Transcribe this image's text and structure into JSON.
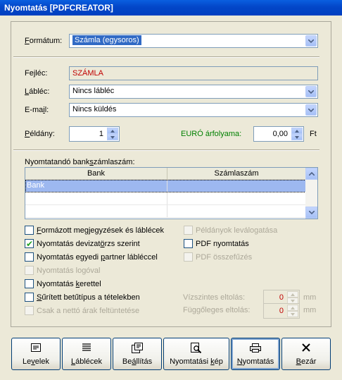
{
  "window": {
    "title": "Nyomtatás [PDFCREATOR]"
  },
  "format": {
    "label_pre": "F",
    "label_rest": "ormátum:",
    "value": "Számla (egysoros)"
  },
  "header": {
    "label_pre": "Fe",
    "label_u": "j",
    "label_rest": "léc:",
    "value": "SZÁMLA"
  },
  "footer": {
    "label_pre": "",
    "label_u": "L",
    "label_rest": "ábléc:",
    "value": "Nincs lábléc"
  },
  "email": {
    "label_pre": "E-ma",
    "label_u": "i",
    "label_rest": "l:",
    "value": "Nincs küldés"
  },
  "copies": {
    "label_pre": "",
    "label_u": "P",
    "label_rest": "éldány:",
    "value": "1"
  },
  "euro": {
    "label": "EURÓ árfolyama:",
    "value": "0,00",
    "unit": "Ft",
    "color": "#008000"
  },
  "bank_section": {
    "label_pre": "Nyomtatandó bank",
    "label_u": "s",
    "label_rest": "zámlaszám:"
  },
  "bank_table": {
    "columns": [
      "Bank",
      "Számlaszám"
    ],
    "rows": [
      [
        "Bank",
        ""
      ],
      [
        "",
        ""
      ],
      [
        "",
        ""
      ]
    ]
  },
  "checkboxes_left": [
    {
      "label_pre": "",
      "label_u": "F",
      "label_rest": "ormázott megjegyzések és láblécek",
      "checked": false,
      "enabled": true
    },
    {
      "label_pre": "Nyomtatás devizat",
      "label_u": "ö",
      "label_rest": "rzs szerint",
      "checked": true,
      "enabled": true
    },
    {
      "label_pre": "Nyomtatás egyedi ",
      "label_u": "p",
      "label_rest": "artner lábléccel",
      "checked": false,
      "enabled": true
    },
    {
      "label_pre": "Nyomtatás logóval",
      "label_u": "",
      "label_rest": "",
      "checked": false,
      "enabled": false
    },
    {
      "label_pre": "Nyomtatás ",
      "label_u": "k",
      "label_rest": "erettel",
      "checked": false,
      "enabled": true
    },
    {
      "label_pre": "",
      "label_u": "S",
      "label_rest": "űrített betűtípus a tételekben",
      "checked": false,
      "enabled": true
    },
    {
      "label_pre": "Csak a nettó árak feltüntetése",
      "label_u": "",
      "label_rest": "",
      "checked": false,
      "enabled": false
    }
  ],
  "checkboxes_right": [
    {
      "label": "Példányok leválogatása",
      "checked": false,
      "enabled": false
    },
    {
      "label": "PDF nyomtatás",
      "checked": false,
      "enabled": true
    },
    {
      "label": "PDF összefűzés",
      "checked": false,
      "enabled": false
    }
  ],
  "offset_h": {
    "label": "Vízszintes eltolás:",
    "value": "0",
    "unit": "mm"
  },
  "offset_v": {
    "label": "Függőleges eltolás:",
    "value": "0",
    "unit": "mm"
  },
  "buttons": [
    {
      "label_pre": "Le",
      "label_u": "v",
      "label_rest": "elek",
      "icon": "letter-icon"
    },
    {
      "label_pre": "",
      "label_u": "L",
      "label_rest": "áblécek",
      "icon": "lines-icon"
    },
    {
      "label_pre": "Be",
      "label_u": "á",
      "label_rest": "llítás",
      "icon": "settings-icon"
    },
    {
      "label_pre": "Nyomtatási ",
      "label_u": "k",
      "label_rest": "ép",
      "icon": "preview-icon"
    },
    {
      "label_pre": "",
      "label_u": "N",
      "label_rest": "yomtatás",
      "icon": "printer-icon"
    },
    {
      "label_pre": "",
      "label_u": "B",
      "label_rest": "ezár",
      "icon": "close-icon"
    }
  ]
}
